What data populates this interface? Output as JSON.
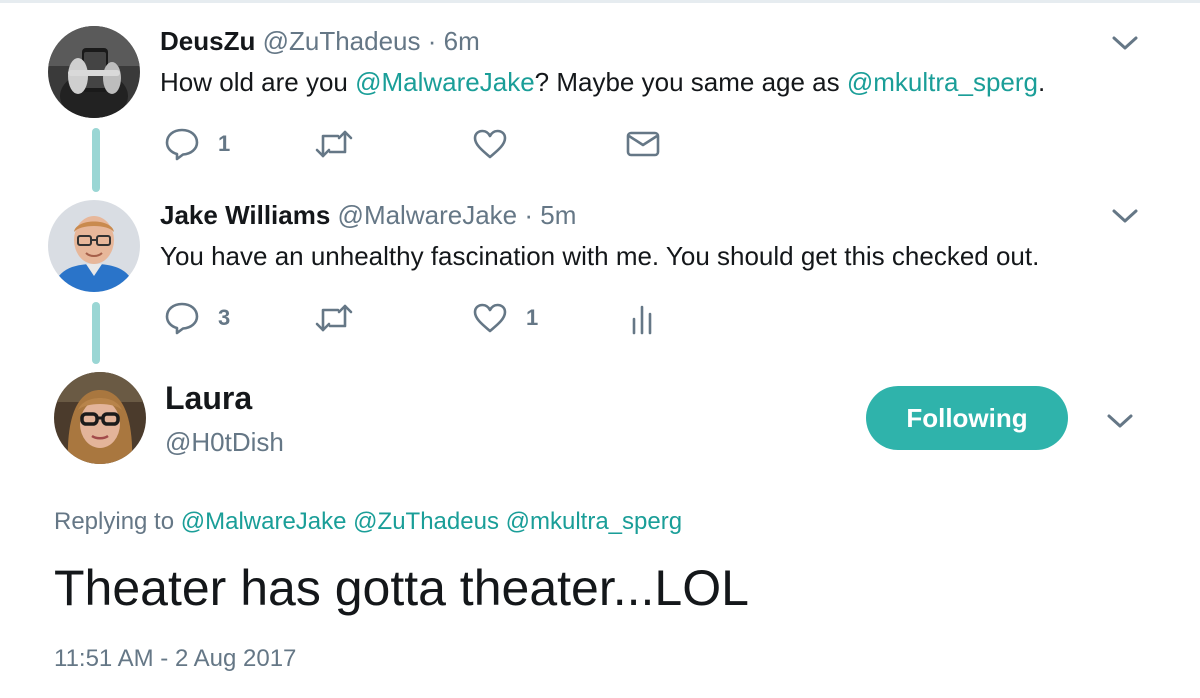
{
  "tweets": [
    {
      "name": "DeusZu",
      "handle": "@ZuThadeus",
      "separator": "·",
      "time": "6m",
      "text_parts": [
        "How old are you ",
        "@MalwareJake",
        "? Maybe you same age as ",
        "@mkultra_sperg",
        "."
      ],
      "reply_count": "1",
      "retweet_count": "",
      "like_count": "",
      "fourth_action_icon": "envelope-icon"
    },
    {
      "name": "Jake Williams",
      "handle": "@MalwareJake",
      "separator": "·",
      "time": "5m",
      "text": "You have an unhealthy fascination with me. You should get this checked out.",
      "reply_count": "3",
      "retweet_count": "",
      "like_count": "1",
      "fourth_action_icon": "analytics-icon"
    }
  ],
  "focused_tweet": {
    "name": "Laura",
    "handle": "@H0tDish",
    "follow_label": "Following",
    "replying_label": "Replying to",
    "replying_to": [
      "@MalwareJake",
      "@ZuThadeus",
      "@mkultra_sperg"
    ],
    "text": "Theater has gotta theater...LOL",
    "timestamp": "11:51 AM - 2 Aug 2017"
  },
  "colors": {
    "accent": "#2fb3ab",
    "mention": "#1a9e98",
    "muted": "#657786",
    "thread_line": "#9ad6d4",
    "text": "#14171a"
  }
}
